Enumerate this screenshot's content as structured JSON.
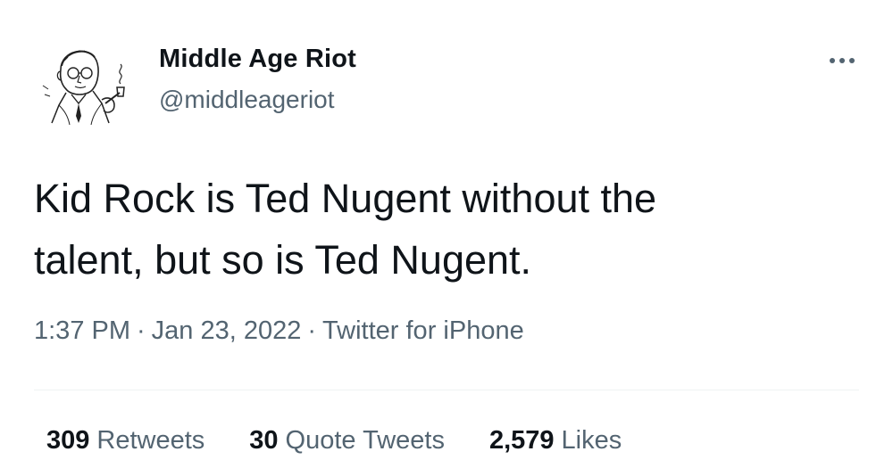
{
  "user": {
    "display_name": "Middle Age Riot",
    "handle": "@middleageriot",
    "avatar_icon": "vintage-man-with-pipe-avatar"
  },
  "tweet": {
    "text": "Kid Rock is Ted Nugent without the\ntalent, but so is Ted Nugent.",
    "time": "1:37 PM",
    "date": "Jan 23, 2022",
    "source": "Twitter for iPhone",
    "separator": "·"
  },
  "stats": {
    "retweets_count": "309",
    "retweets_label": "Retweets",
    "quote_count": "30",
    "quote_label": "Quote Tweets",
    "likes_count": "2,579",
    "likes_label": "Likes"
  },
  "colors": {
    "text_primary": "#0f1419",
    "text_secondary": "#536471",
    "divider": "#eff3f4"
  },
  "icons": {
    "more": "more-horizontal-icon"
  }
}
